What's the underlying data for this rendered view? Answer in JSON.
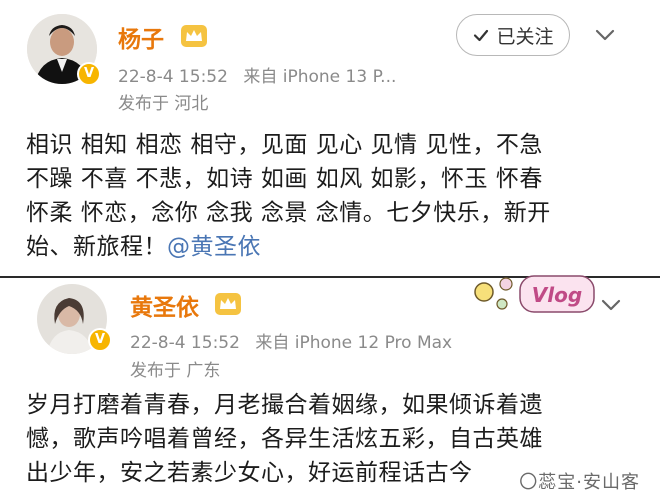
{
  "post1": {
    "author": "杨子",
    "timestamp": "22-8-4 15:52",
    "source": "来自 iPhone 13 P...",
    "location": "发布于 河北",
    "follow_label": "已关注",
    "body_lines": [
      "相识 相知 相恋 相守，见面 见心 见情 见性，不急",
      "不躁 不喜 不悲，如诗 如画 如风 如影，怀玉 怀春",
      "怀柔 怀恋，念你 念我 念景 念情。七夕快乐，新开",
      "始、新旅程！"
    ],
    "mention": "@黄圣依"
  },
  "post2": {
    "author": "黄圣依",
    "timestamp": "22-8-4 15:52",
    "source": "来自 iPhone 12 Pro Max",
    "location": "发布于 广东",
    "sticker_text": "Vlog",
    "body_lines": [
      "岁月打磨着青春，月老撮合着姻缘，如果倾诉着遗",
      "憾，歌声吟唱着曾经，各异生活炫五彩，自古英雄",
      "出少年，安之若素少女心，好运前程话古今"
    ]
  },
  "watermark": "〇蕊宝·安山客",
  "icons": {
    "verified": "verified-v-badge-icon",
    "crown": "vip-crown-icon",
    "check": "check-icon",
    "chevron": "chevron-down-icon"
  },
  "colors": {
    "name_orange": "#e8780c",
    "mention_blue": "#4a76b4",
    "meta_gray": "#8a8a8a",
    "badge_gold": "#f7b500"
  }
}
